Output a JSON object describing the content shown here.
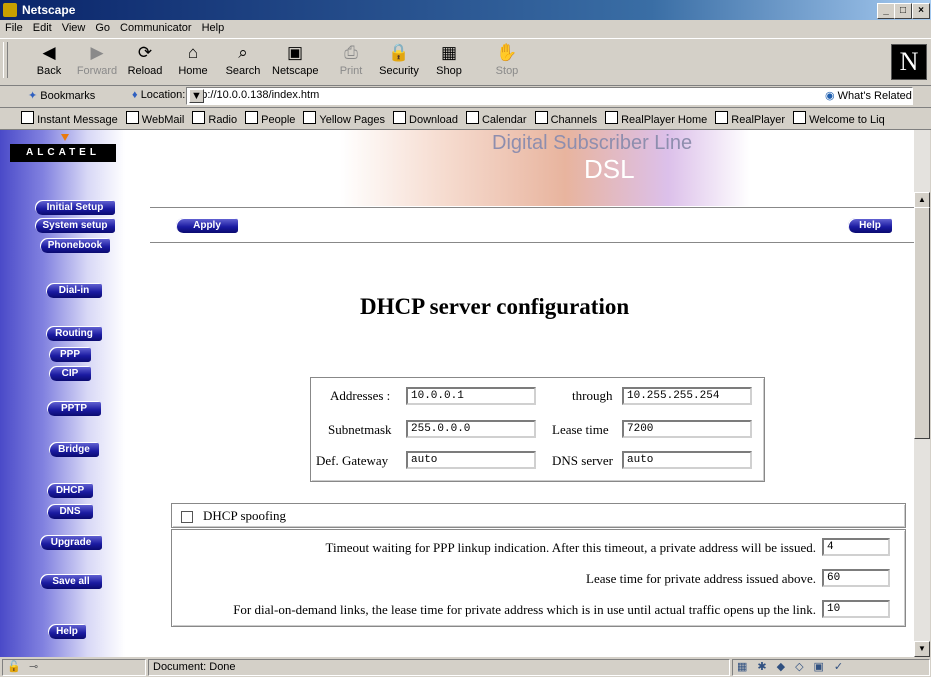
{
  "window": {
    "title": "Netscape",
    "min": "_",
    "max": "□",
    "close": "×"
  },
  "menu": [
    "File",
    "Edit",
    "View",
    "Go",
    "Communicator",
    "Help"
  ],
  "toolbar": {
    "buttons": [
      {
        "label": "Back",
        "icon": "back-arrow-icon",
        "glyph": "◀",
        "enabled": true
      },
      {
        "label": "Forward",
        "icon": "forward-arrow-icon",
        "glyph": "▶",
        "enabled": false
      },
      {
        "label": "Reload",
        "icon": "reload-icon",
        "glyph": "⟳",
        "enabled": true
      },
      {
        "label": "Home",
        "icon": "home-icon",
        "glyph": "⌂",
        "enabled": true
      },
      {
        "label": "Search",
        "icon": "search-icon",
        "glyph": "⌕",
        "enabled": true
      },
      {
        "label": "Netscape",
        "icon": "netscape-icon",
        "glyph": "▣",
        "enabled": true
      },
      {
        "label": "Print",
        "icon": "printer-icon",
        "glyph": "⎙",
        "enabled": false
      },
      {
        "label": "Security",
        "icon": "lock-icon",
        "glyph": "🔒",
        "enabled": true
      },
      {
        "label": "Shop",
        "icon": "shop-icon",
        "glyph": "▦",
        "enabled": true
      },
      {
        "label": "Stop",
        "icon": "stop-icon",
        "glyph": "✋",
        "enabled": false
      }
    ],
    "logo": "N"
  },
  "location": {
    "bookmarks": "Bookmarks",
    "label": "Location:",
    "url": "http://10.0.0.138/index.htm",
    "related": "What's Related"
  },
  "personal": [
    "Instant Message",
    "WebMail",
    "Radio",
    "People",
    "Yellow Pages",
    "Download",
    "Calendar",
    "Channels",
    "RealPlayer Home",
    "RealPlayer",
    "Welcome to Liq"
  ],
  "page": {
    "brand": "ALCATEL",
    "banner_title": "Digital Subscriber Line",
    "banner_sub": "DSL",
    "nav": [
      "Initial Setup",
      "System setup",
      "Phonebook",
      "Dial-in",
      "Routing",
      "PPP",
      "CIP",
      "PPTP",
      "Bridge",
      "DHCP",
      "DNS",
      "Upgrade",
      "Save all",
      "Help"
    ],
    "apply": "Apply",
    "help": "Help",
    "heading": "DHCP server configuration",
    "form": {
      "addresses_label": "Addresses :",
      "addresses": "10.0.0.1",
      "through_label": "through",
      "through": "10.255.255.254",
      "subnet_label": "Subnetmask",
      "subnet": "255.0.0.0",
      "lease_label": "Lease time",
      "lease": "7200",
      "gateway_label": "Def. Gateway",
      "gateway": "auto",
      "dns_label": "DNS server",
      "dns": "auto"
    },
    "spoofing": {
      "label": "DHCP spoofing",
      "checked": false,
      "rows": [
        {
          "label": "Timeout waiting for PPP linkup indication. After this timeout, a private address will be issued.",
          "value": "4"
        },
        {
          "label": "Lease time for private address issued above.",
          "value": "60"
        },
        {
          "label": "For dial-on-demand links, the lease time for private address which is in use until actual traffic opens up the link.",
          "value": "10"
        }
      ]
    }
  },
  "status": {
    "text": "Document: Done"
  }
}
